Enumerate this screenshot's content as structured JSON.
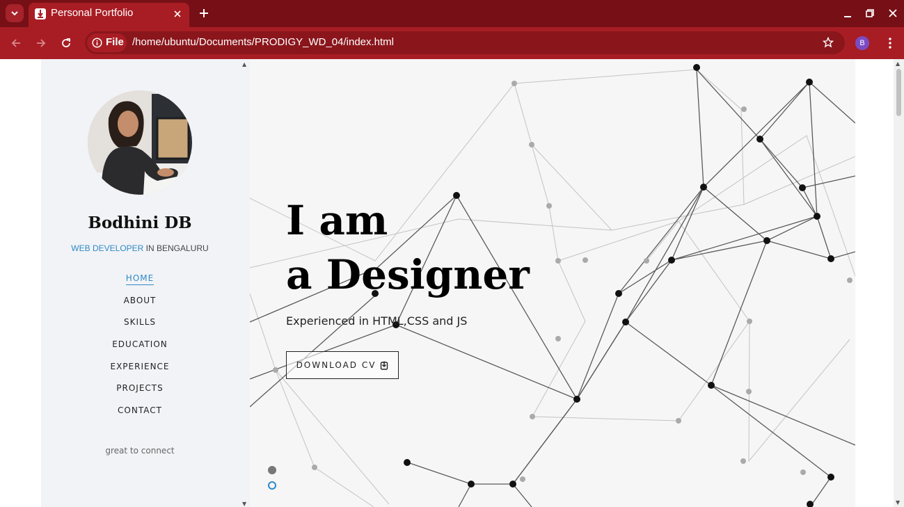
{
  "browser": {
    "tab_title": "Personal Portfolio",
    "chip_label": "File",
    "url": "/home/ubuntu/Documents/PRODIGY_WD_04/index.html",
    "profile_initial": "B",
    "icons": [
      "tab-search-icon",
      "favicon-icon",
      "close-icon",
      "new-tab-icon",
      "minimize-icon",
      "restore-icon",
      "back-icon",
      "forward-icon",
      "reload-icon",
      "info-icon",
      "star-icon",
      "menu-icon"
    ]
  },
  "sidebar": {
    "name": "Bodhini DB",
    "role_accent": "WEB DEVELOPER",
    "role_rest": " IN BENGALURU",
    "nav": [
      {
        "label": "HOME",
        "active": true
      },
      {
        "label": "ABOUT",
        "active": false
      },
      {
        "label": "SKILLS",
        "active": false
      },
      {
        "label": "EDUCATION",
        "active": false
      },
      {
        "label": "EXPERIENCE",
        "active": false
      },
      {
        "label": "PROJECTS",
        "active": false
      },
      {
        "label": "CONTACT",
        "active": false
      }
    ],
    "footer_text": "great to connect"
  },
  "hero": {
    "line1": "I am",
    "line2": "a Designer",
    "subtitle": "Experienced in HTML,CSS and JS",
    "cta_label": "DOWNLOAD CV",
    "slides": 2,
    "active_slide": 1
  },
  "colors": {
    "tabbar": "#761016",
    "toolbar": "#a81d24",
    "accent": "#2f89c6",
    "sidebar_bg": "#f2f3f7"
  }
}
